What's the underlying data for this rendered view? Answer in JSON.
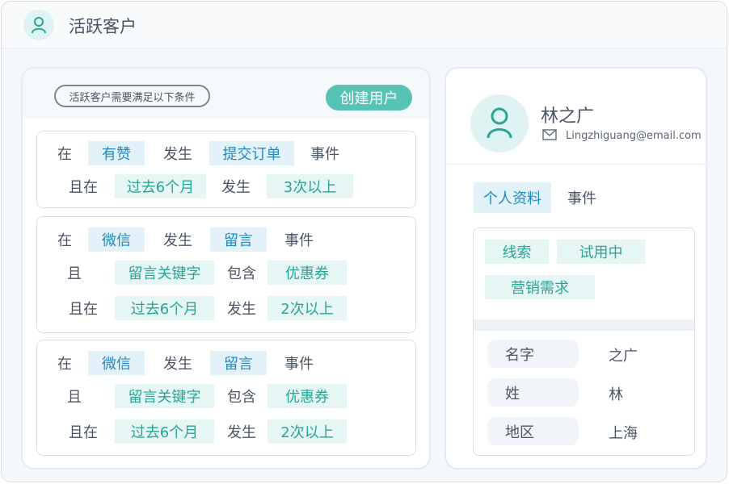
{
  "app": {
    "title": "活跃客户"
  },
  "conditions": {
    "header_label": "活跃客户需要满足以下条件",
    "create_button": "创建用户",
    "rule1": {
      "r1": [
        "在",
        "有赞",
        "发生",
        "提交订单",
        "事件"
      ],
      "r2": [
        "且在",
        "过去6个月",
        "发生",
        "3次以上"
      ]
    },
    "rule2": {
      "r1": [
        "在",
        "微信",
        "发生",
        "留言",
        "事件"
      ],
      "r2": [
        "且",
        "留言关键字",
        "包含",
        "优惠券"
      ],
      "r3": [
        "且在",
        "过去6个月",
        "发生",
        "2次以上"
      ]
    },
    "rule3": {
      "r1": [
        "在",
        "微信",
        "发生",
        "留言",
        "事件"
      ],
      "r2": [
        "且",
        "留言关键字",
        "包含",
        "优惠券"
      ],
      "r3": [
        "且在",
        "过去6个月",
        "发生",
        "2次以上"
      ]
    }
  },
  "profile": {
    "name": "林之广",
    "email": "Lingzhiguang@email.com",
    "tabs": [
      "个人资料",
      "事件"
    ],
    "tags": [
      "线索",
      "试用中",
      "营销需求"
    ],
    "fields": [
      {
        "label": "名字",
        "value": "之广"
      },
      {
        "label": "姓",
        "value": "林"
      },
      {
        "label": "地区",
        "value": "上海"
      }
    ]
  },
  "colors": {
    "accent_teal": "#57c3b4",
    "tag_blue": "#1f8bc4",
    "tag_teal": "#2aa595"
  },
  "icons": {
    "user": "user-icon",
    "mail": "mail-icon"
  }
}
